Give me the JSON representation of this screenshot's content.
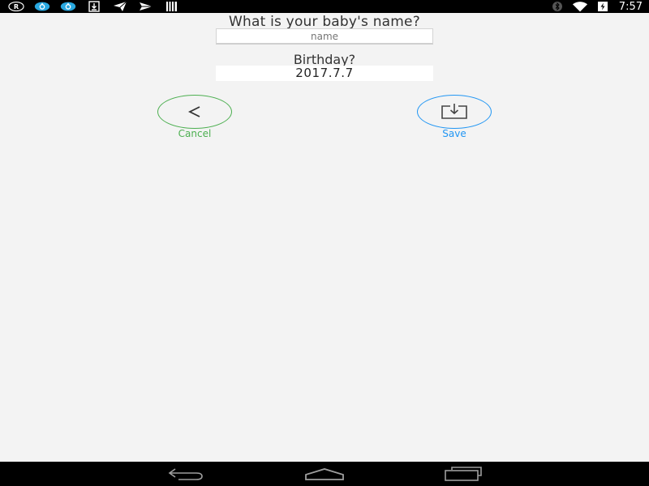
{
  "status_bar": {
    "time": "7:57",
    "left_icons": [
      "r-circle-icon",
      "app-drop-icon",
      "app-drop-icon",
      "download-icon",
      "send-icon",
      "send-outline-icon",
      "barcode-icon"
    ],
    "right_icons": [
      "bluetooth-icon",
      "wifi-icon",
      "battery-charging-icon"
    ]
  },
  "form": {
    "name_question": "What is your baby's name?",
    "name_placeholder": "name",
    "birthday_label": "Birthday?",
    "birthday_value": "2017.7.7"
  },
  "buttons": {
    "cancel_label": "Cancel",
    "save_label": "Save",
    "cancel_color": "#4caf50",
    "save_color": "#2196f3"
  },
  "nav_bar": {
    "icons": [
      "back-icon",
      "home-icon",
      "recents-icon"
    ]
  }
}
